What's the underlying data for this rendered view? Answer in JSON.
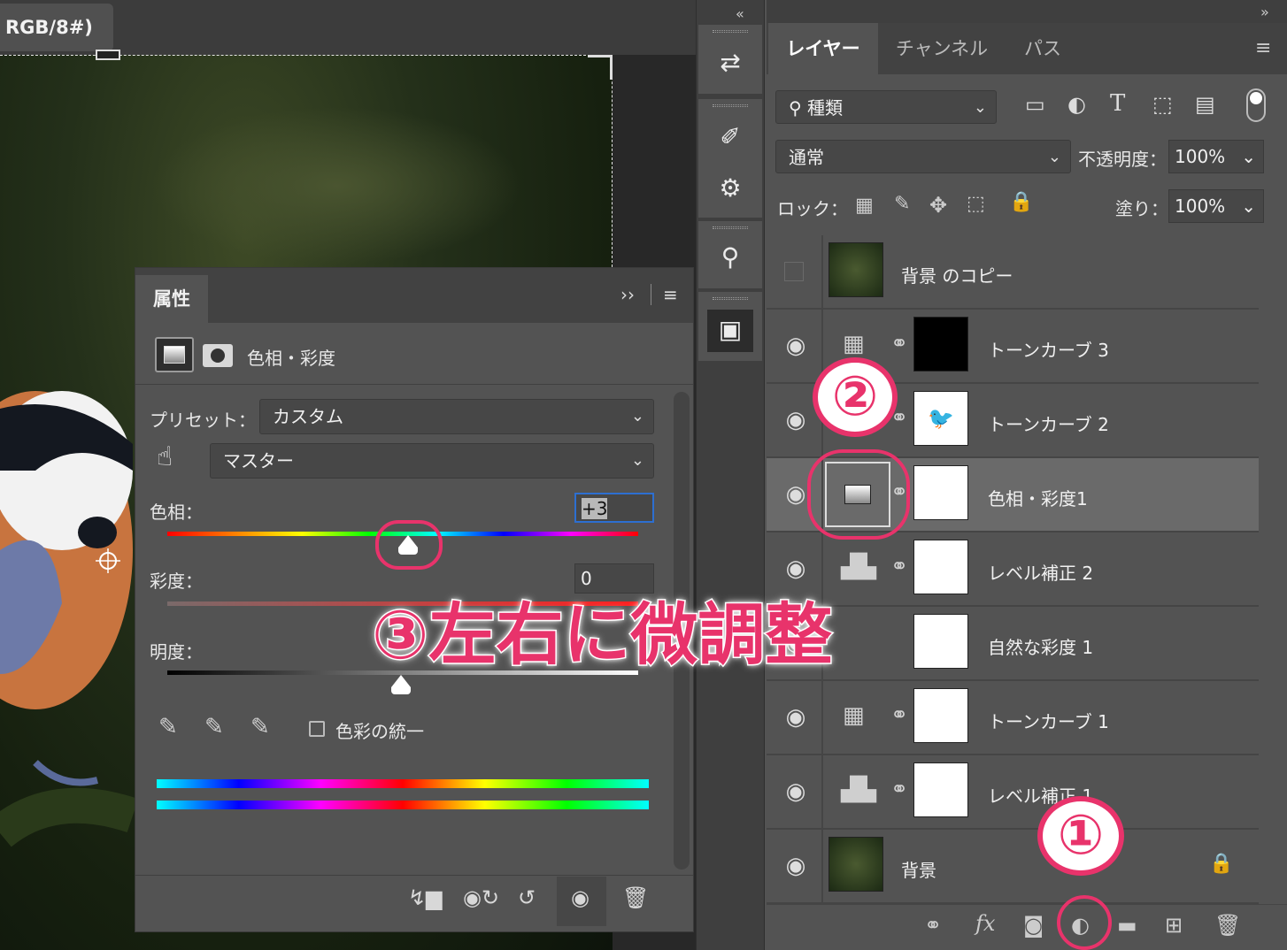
{
  "document": {
    "tab_label": "RGB/8#)"
  },
  "properties": {
    "tab_label": "属性",
    "collapse_icon": "››",
    "menu_icon": "≡",
    "adjustment_title": "色相・彩度",
    "preset_label": "プリセット：",
    "preset_value": "カスタム",
    "channel_value": "マスター",
    "hue_label": "色相：",
    "hue_value": "+3",
    "saturation_label": "彩度：",
    "saturation_value": "0",
    "lightness_label": "明度：",
    "colorize_label": "色彩の統一"
  },
  "layers": {
    "tabs": [
      "レイヤー",
      "チャンネル",
      "パス"
    ],
    "filter_label": "種類",
    "blend_mode": "通常",
    "opacity_label": "不透明度：",
    "opacity_value": "100%",
    "lock_label": "ロック：",
    "fill_label": "塗り：",
    "fill_value": "100%",
    "items": [
      {
        "name": "背景 のコピー",
        "visible": false,
        "kind": "photo"
      },
      {
        "name": "トーンカーブ 3",
        "visible": true,
        "kind": "curves",
        "mask": "black"
      },
      {
        "name": "トーンカーブ 2",
        "visible": true,
        "kind": "curves",
        "mask": "bird"
      },
      {
        "name": "色相・彩度1",
        "visible": true,
        "kind": "hue-saturation",
        "mask": "white",
        "selected": true
      },
      {
        "name": "レベル補正 2",
        "visible": true,
        "kind": "levels",
        "mask": "white"
      },
      {
        "name": "自然な彩度 1",
        "visible": true,
        "kind": "vibrance",
        "mask": "white"
      },
      {
        "name": "トーンカーブ 1",
        "visible": true,
        "kind": "curves",
        "mask": "white"
      },
      {
        "name": "レベル補正 1",
        "visible": true,
        "kind": "levels",
        "mask": "white"
      },
      {
        "name": "背景",
        "visible": true,
        "kind": "photo",
        "locked": true
      }
    ]
  },
  "annotations": {
    "step1": "①",
    "step2": "②",
    "step3_text": "③左右に微調整"
  },
  "colors": {
    "accent": "#e8336b",
    "panel": "#535353",
    "panel_dark": "#424242"
  }
}
